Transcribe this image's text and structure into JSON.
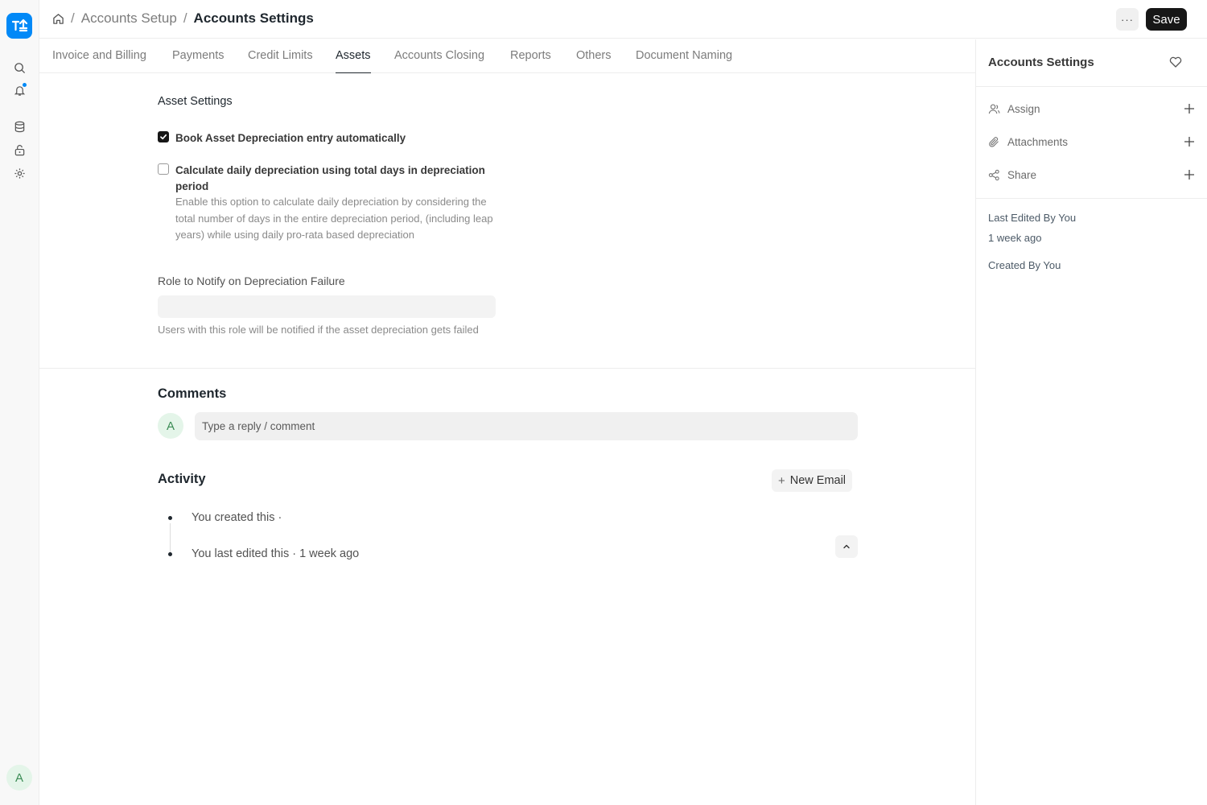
{
  "breadcrumb": {
    "home_icon": "home-icon",
    "items": [
      "Accounts Setup",
      "Accounts Settings"
    ],
    "separator": "/"
  },
  "toolbar": {
    "more_label": "···",
    "save_label": "Save"
  },
  "rail": {
    "icons": [
      "search-icon",
      "bell-icon",
      "database-icon",
      "lock-icon",
      "gear-icon"
    ],
    "avatar_initial": "A",
    "accent": "#0289f7"
  },
  "tabs": [
    {
      "label": "Invoice and Billing",
      "active": false
    },
    {
      "label": "Payments",
      "active": false
    },
    {
      "label": "Credit Limits",
      "active": false
    },
    {
      "label": "Assets",
      "active": true
    },
    {
      "label": "Accounts Closing",
      "active": false
    },
    {
      "label": "Reports",
      "active": false
    },
    {
      "label": "Others",
      "active": false
    },
    {
      "label": "Document Naming",
      "active": false
    }
  ],
  "asset_settings": {
    "title": "Asset Settings",
    "book_depreciation": {
      "label": "Book Asset Depreciation entry automatically",
      "checked": true
    },
    "daily_depreciation": {
      "label": "Calculate daily depreciation using total days in depreciation period",
      "checked": false,
      "description": "Enable this option to calculate daily depreciation by considering the total number of days in the entire depreciation period, (including leap years) while using daily pro-rata based depreciation"
    },
    "role_field": {
      "label": "Role to Notify on Depreciation Failure",
      "value": "",
      "description": "Users with this role will be notified if the asset depreciation gets failed"
    }
  },
  "comments": {
    "title": "Comments",
    "avatar_initial": "A",
    "placeholder": "Type a reply / comment"
  },
  "activity": {
    "title": "Activity",
    "new_email_label": "New Email",
    "items": [
      "You created this ·",
      "You last edited this · 1 week ago"
    ]
  },
  "sidebar": {
    "title": "Accounts Settings",
    "actions": [
      {
        "label": "Assign",
        "icon": "user-icon"
      },
      {
        "label": "Attachments",
        "icon": "paperclip-icon"
      },
      {
        "label": "Share",
        "icon": "share-icon"
      }
    ],
    "last_edited_label": "Last Edited By You",
    "last_edited_time": "1 week ago",
    "created_label": "Created By You"
  }
}
